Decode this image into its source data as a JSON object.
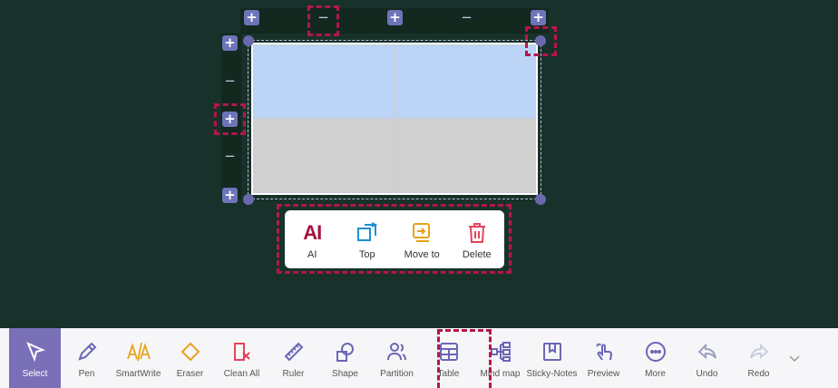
{
  "table_controls": {
    "top": [
      "+",
      "−",
      "+",
      "−",
      "+"
    ],
    "left": [
      "+",
      "−",
      "+",
      "−",
      "+"
    ]
  },
  "context_menu": {
    "ai_glyph": "AI",
    "items": [
      {
        "label": "AI",
        "icon": "ai-icon",
        "color": "#a5123f"
      },
      {
        "label": "Top",
        "icon": "bring-to-top-icon",
        "color": "#1e8fd6"
      },
      {
        "label": "Move to",
        "icon": "move-to-icon",
        "color": "#e7a21b"
      },
      {
        "label": "Delete",
        "icon": "trash-icon",
        "color": "#e3455a"
      }
    ]
  },
  "toolbar": {
    "items": [
      {
        "label": "Select",
        "icon": "cursor-icon",
        "active": true
      },
      {
        "label": "Pen",
        "icon": "pen-icon",
        "color": "#6b66b6"
      },
      {
        "label": "SmartWrite",
        "icon": "smartwrite-icon",
        "color": "#e7a21b"
      },
      {
        "label": "Eraser",
        "icon": "eraser-icon",
        "color": "#e7a21b"
      },
      {
        "label": "Clean All",
        "icon": "clean-all-icon",
        "color": "#e3455a"
      },
      {
        "label": "Ruler",
        "icon": "ruler-icon",
        "color": "#6b66b6"
      },
      {
        "label": "Shape",
        "icon": "shape-icon",
        "color": "#6b66b6"
      },
      {
        "label": "Partition",
        "icon": "partition-icon",
        "color": "#6b66b6"
      },
      {
        "label": "Table",
        "icon": "table-icon",
        "color": "#6b66b6"
      },
      {
        "label": "Mind map",
        "icon": "mind-map-icon",
        "color": "#6b66b6"
      },
      {
        "label": "Sticky-Notes",
        "icon": "sticky-notes-icon",
        "color": "#6b66b6"
      },
      {
        "label": "Preview",
        "icon": "preview-hand-icon",
        "color": "#6b66b6"
      },
      {
        "label": "More",
        "icon": "more-icon",
        "color": "#6b66b6"
      },
      {
        "label": "Undo",
        "icon": "undo-icon",
        "color": "#9aa0c0"
      },
      {
        "label": "Redo",
        "icon": "redo-icon",
        "color": "#c9cde0"
      }
    ]
  },
  "colors": {
    "canvas_bg": "#18312b",
    "highlight": "#b3174b",
    "accent": "#7a70b8"
  }
}
